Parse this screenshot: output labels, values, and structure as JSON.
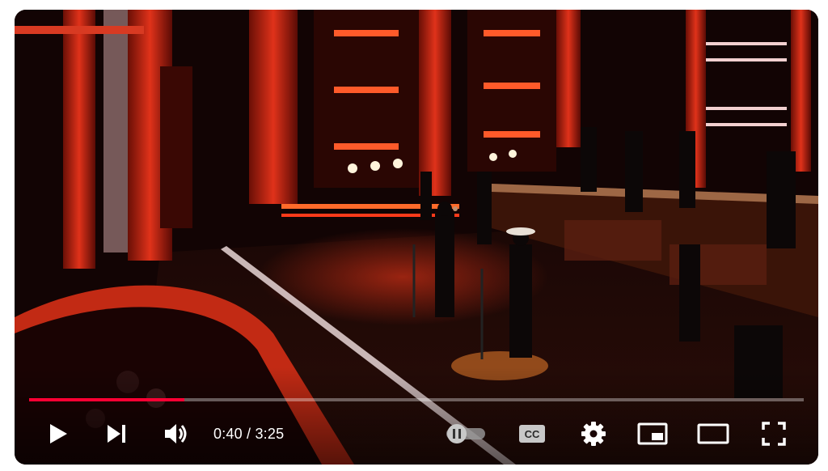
{
  "player": {
    "time": {
      "current": "0:40",
      "separator": " / ",
      "duration": "3:25"
    },
    "progress": {
      "played_fraction": 0.2,
      "loaded_fraction": 0.2
    },
    "autoplay": {
      "state": "paused"
    },
    "colors": {
      "progress_played": "#ff0033",
      "icon": "#ffffff",
      "stage_red": "#d81e10"
    },
    "icons": {
      "play": "play-icon",
      "next": "skip-next-icon",
      "volume": "volume-icon",
      "autoplay": "autoplay-toggle-icon",
      "captions": "captions-icon",
      "settings": "gear-icon",
      "miniplayer": "miniplayer-icon",
      "theater": "theater-mode-icon",
      "fullscreen": "fullscreen-icon"
    }
  }
}
